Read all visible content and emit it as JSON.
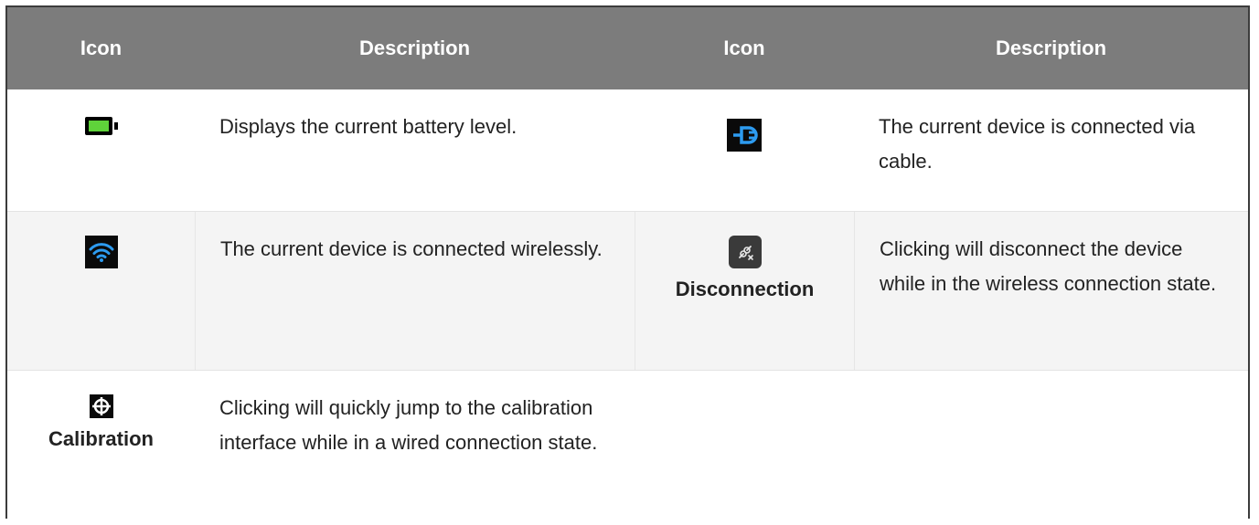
{
  "headers": [
    "Icon",
    "Description",
    "Icon",
    "Description"
  ],
  "rows": [
    {
      "left_icon": "battery-icon",
      "left_desc": "Displays the current battery level.",
      "right_icon": "cable-connection-icon",
      "right_desc": "The current device is connected via cable."
    },
    {
      "left_icon": "wifi-icon",
      "left_desc": "The current device is connected wirelessly.",
      "right_icon": "disconnect-icon",
      "right_label": "Disconnection",
      "right_desc": "Clicking will disconnect the device while in the wireless connection state."
    },
    {
      "left_icon": "calibration-target-icon",
      "left_label": "Calibration",
      "left_desc": "Clicking will quickly jump to the calibration interface while in a wired connection state."
    }
  ],
  "colors": {
    "header_bg": "#7c7c7c",
    "battery_fill": "#5fd33a",
    "accent_blue": "#2d9bf0"
  }
}
